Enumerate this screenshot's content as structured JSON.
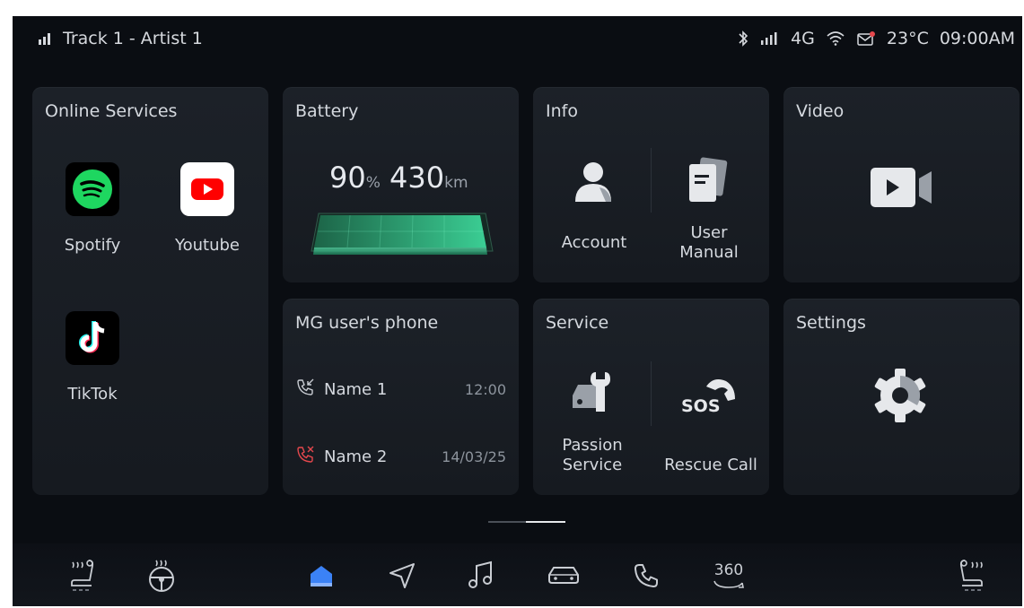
{
  "status_bar": {
    "now_playing": "Track 1 - Artist 1",
    "network": "4G",
    "temperature": "23°C",
    "time": "09:00AM",
    "icons": [
      "signal-bars-icon",
      "bluetooth-icon",
      "cell-signal-icon",
      "wifi-icon",
      "message-icon"
    ]
  },
  "online_services": {
    "title": "Online Services",
    "apps": [
      {
        "label": "Spotify",
        "icon": "spotify-icon",
        "color": "#1ed760"
      },
      {
        "label": "Youtube",
        "icon": "youtube-icon",
        "color": "#ff0000"
      },
      {
        "label": "TikTok",
        "icon": "tiktok-icon",
        "color": "#ffffff"
      }
    ]
  },
  "battery": {
    "title": "Battery",
    "percent": "90",
    "percent_unit": "%",
    "range": "430",
    "range_unit": "km",
    "charge_level": 0.9,
    "color": "#37d08b"
  },
  "info": {
    "title": "Info",
    "items": [
      {
        "label": "Account",
        "icon": "account-icon"
      },
      {
        "label_line1": "User",
        "label_line2": "Manual",
        "icon": "user-manual-icon"
      }
    ]
  },
  "video": {
    "title": "Video",
    "icon": "video-camera-icon"
  },
  "phone": {
    "title": "MG user's phone",
    "calls": [
      {
        "name": "Name 1",
        "time": "12:00",
        "type": "incoming",
        "icon": "incoming-call-icon"
      },
      {
        "name": "Name 2",
        "time": "14/03/25",
        "type": "missed",
        "icon": "missed-call-icon",
        "color": "#e5484d"
      }
    ]
  },
  "service": {
    "title": "Service",
    "items": [
      {
        "label_line1": "Passion",
        "label_line2": "Service",
        "icon": "car-wrench-icon"
      },
      {
        "label": "Rescue Call",
        "icon": "sos-call-icon",
        "badge": "SOS"
      }
    ]
  },
  "settings": {
    "title": "Settings",
    "icon": "gear-icon"
  },
  "pager": {
    "pages": 2,
    "active": 2
  },
  "dock": {
    "accent": "#3b82f6",
    "items": [
      {
        "name": "seat-heat-left",
        "icon": "seat-heat-icon"
      },
      {
        "name": "steering-heat",
        "icon": "steering-wheel-heat-icon"
      },
      {
        "name": "home",
        "icon": "home-icon",
        "active": true
      },
      {
        "name": "navigation",
        "icon": "navigation-arrow-icon"
      },
      {
        "name": "music",
        "icon": "music-note-icon"
      },
      {
        "name": "vehicle",
        "icon": "car-icon"
      },
      {
        "name": "phone",
        "icon": "phone-icon"
      },
      {
        "name": "camera-360",
        "icon": "camera-360-icon",
        "label": "360"
      },
      {
        "name": "seat-heat-right",
        "icon": "seat-heat-icon"
      }
    ]
  }
}
